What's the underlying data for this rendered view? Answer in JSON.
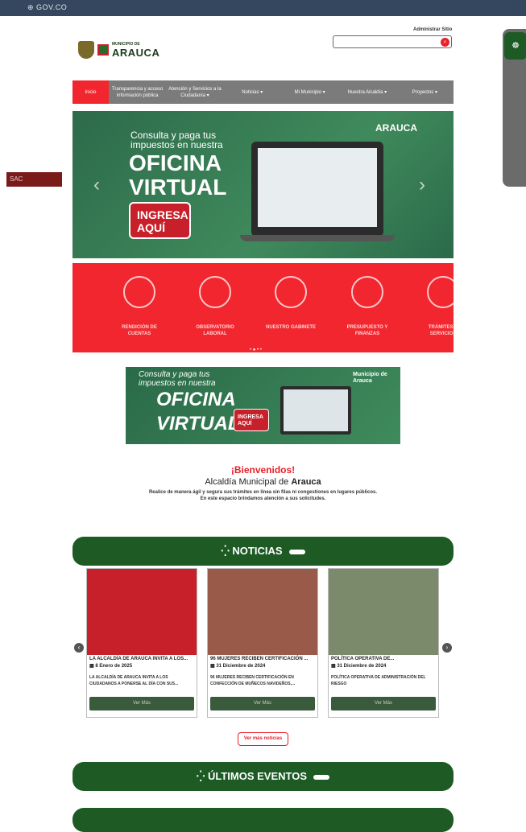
{
  "govbar": {
    "logo": "⊕ GOV.CO"
  },
  "header": {
    "admin_link": "Administrar Sitio",
    "brand_small": "MUNICIPIO DE",
    "brand_big": "ARAUCA",
    "search_placeholder": ""
  },
  "nav": {
    "items": [
      {
        "label": "Inicio"
      },
      {
        "label": "Transparencia y acceso información pública"
      },
      {
        "label": "Atención y Servicios a la Ciudadanía ▾"
      },
      {
        "label": "Noticias ▾"
      },
      {
        "label": "Mi Municipio ▾"
      },
      {
        "label": "Nuestra Alcaldía ▾"
      },
      {
        "label": "Proyectos ▾"
      }
    ]
  },
  "hero": {
    "subtitle": "Consulta y paga tus impuestos en nuestra",
    "title": "OFICINA VIRTUAL",
    "cta": "INGRESA AQUÍ",
    "logo": "ARAUCA",
    "prev": "‹",
    "next": "›"
  },
  "quicklinks": [
    {
      "label": "RENDICIÓN DE CUENTAS"
    },
    {
      "label": "OBSERVATORIO LABORAL"
    },
    {
      "label": "NUESTRO GABINETE"
    },
    {
      "label": "PRESUPUESTO Y FINANZAS"
    },
    {
      "label": "TRÁMITES Y SERVICIOS"
    }
  ],
  "carousel_dots": "• ● • •",
  "banner2": {
    "subtitle": "Consulta y paga tus impuestos en nuestra",
    "title": "OFICINA VIRTUAL",
    "cta": "INGRESA AQUÍ",
    "logo": "Municipio de Arauca"
  },
  "welcome": {
    "heading": "¡Bienvenidos!",
    "subheading_light": "Alcaldía Municipal de ",
    "subheading_bold": "Arauca",
    "text1": "Realice de manera ágil y segura sus trámites en línea sin filas ni congestiones en lugares públicos.",
    "text2": "En este espacio brindamos atención a sus solicitudes."
  },
  "news_section": {
    "title": "NOTICIAS"
  },
  "news": [
    {
      "title": "LA ALCALDÍA DE ARAUCA INVITA A LOS...",
      "date": "8 Enero de 2025",
      "excerpt": "LA ALCALDÍA DE ARAUCA INVITA A LOS CIUDADANOS A PONERSE AL DÍA CON SUS...",
      "button": "Ver Más",
      "image_color": "#c8202a"
    },
    {
      "title": "96 MUJERES RECIBEN CERTIFICACIÓN ...",
      "date": "31 Diciembre de 2024",
      "excerpt": "96 MUJERES RECIBEN CERTIFICACIÓN EN CONFECCIÓN DE MUÑECOS NAVIDEÑOS,...",
      "button": "Ver Más",
      "image_color": "#9a5a4a"
    },
    {
      "title": "POLÍTICA OPERATIVA DE...",
      "date": "31 Diciembre de 2024",
      "excerpt": "POLÍTICA OPERATIVA DE ADMINISTRACIÓN DEL RIESGO",
      "button": "Ver Más",
      "image_color": "#7a8a6a"
    }
  ],
  "news_nav": {
    "prev": "‹",
    "next": "›"
  },
  "news_more": "Ver más noticias",
  "events_section": {
    "title": "ÚLTIMOS EVENTOS"
  },
  "sac": {
    "label": "SAC"
  },
  "accessibility": {
    "icon": "☸"
  }
}
